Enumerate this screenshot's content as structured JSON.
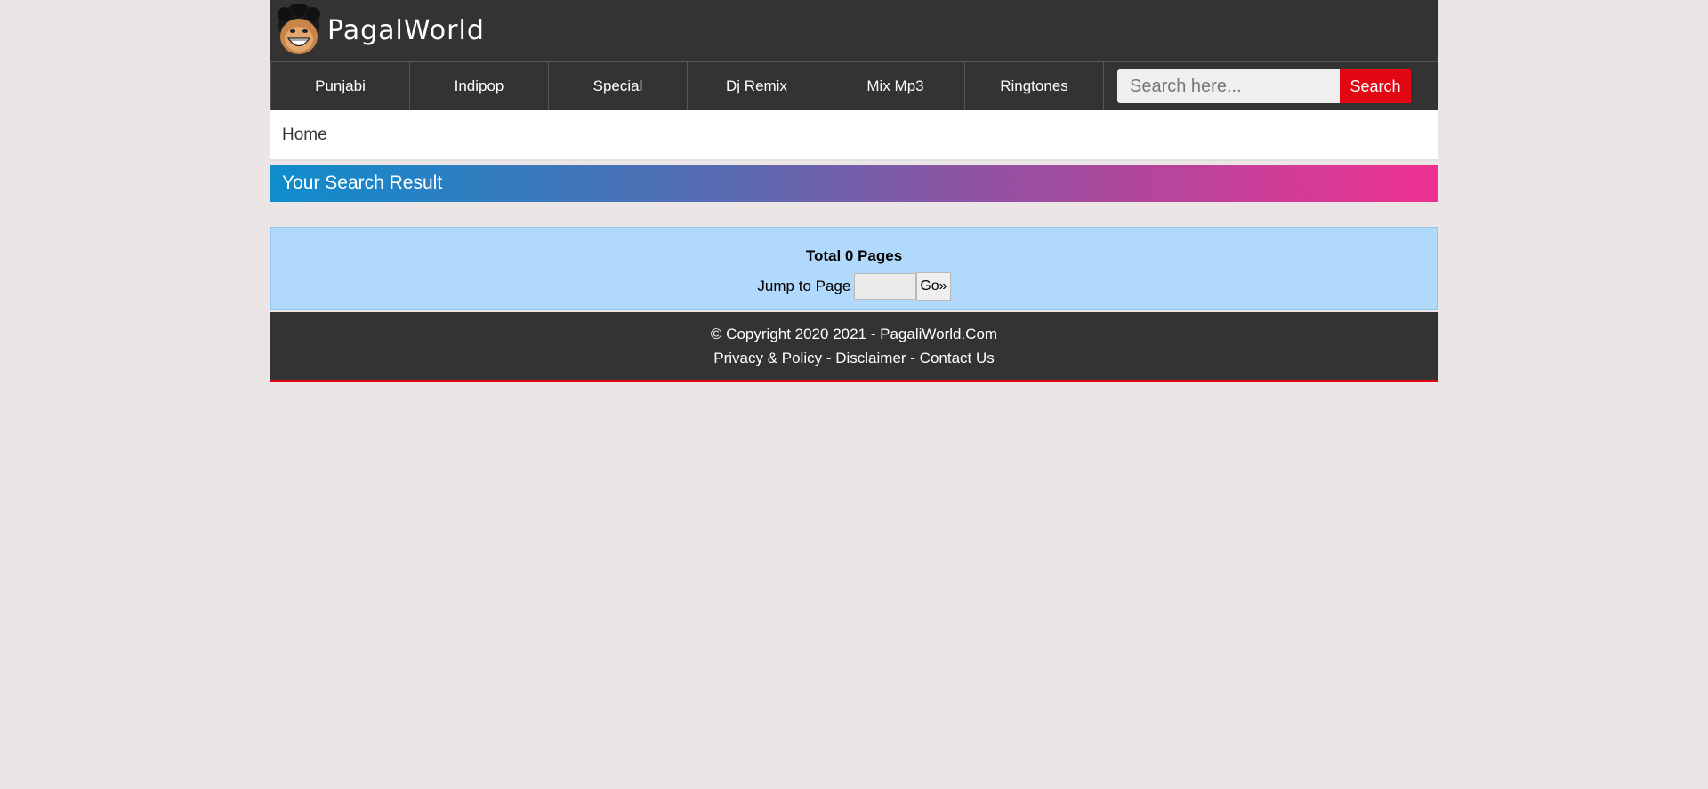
{
  "header": {
    "logo_text": "PagalWorld",
    "logo_icon": "smiling-face-logo"
  },
  "nav": {
    "items": [
      {
        "label": "Punjabi"
      },
      {
        "label": "Indipop"
      },
      {
        "label": "Special"
      },
      {
        "label": "Dj Remix"
      },
      {
        "label": "Mix Mp3"
      },
      {
        "label": "Ringtones"
      }
    ]
  },
  "search": {
    "placeholder": "Search here...",
    "value": "",
    "button_label": "Search"
  },
  "breadcrumb": {
    "home": "Home"
  },
  "results": {
    "title": "Your Search Result"
  },
  "pager": {
    "total_text": "Total 0 Pages",
    "jump_label": "Jump to Page",
    "jump_value": "",
    "go_label": "Go»"
  },
  "footer": {
    "copyright": "© Copyright 2020 2021 - PagaliWorld.Com",
    "links": {
      "privacy": "Privacy & Policy",
      "disclaimer": "Disclaimer",
      "contact": "Contact Us"
    },
    "separator": " - "
  },
  "colors": {
    "page_bg": "#ebe6e5",
    "header_bg": "#333333",
    "accent_red": "#e30613",
    "pager_bg": "#b1d9fb"
  }
}
